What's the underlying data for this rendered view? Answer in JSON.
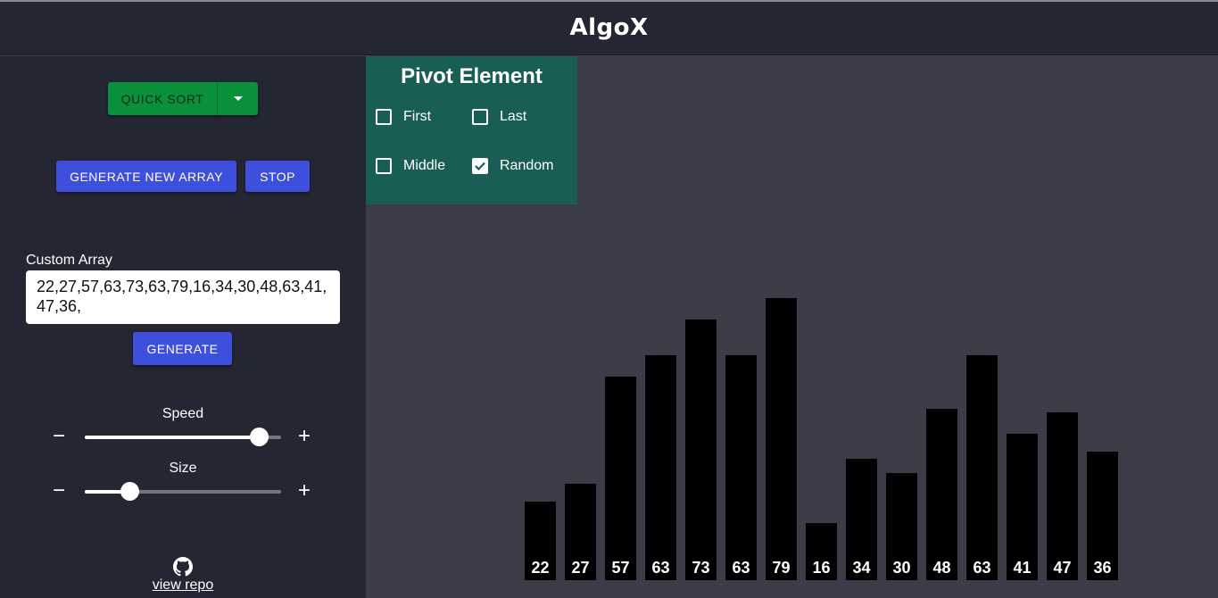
{
  "app": {
    "title": "AlgoX"
  },
  "sidebar": {
    "algorithm_button": {
      "label": "QUICK SORT",
      "color": "#0a8f3a"
    },
    "generate_new_array_label": "GENERATE NEW ARRAY",
    "stop_label": "STOP",
    "custom_array": {
      "label": "Custom Array",
      "value": "22,27,57,63,73,63,79,16,34,30,48,63,41,47,36,"
    },
    "generate_label": "GENERATE",
    "speed": {
      "label": "Speed",
      "minus": "−",
      "plus": "+",
      "level": 0.885
    },
    "size": {
      "label": "Size",
      "minus": "−",
      "plus": "+",
      "level": 0.225
    },
    "repo_link": "view repo"
  },
  "pivot": {
    "title": "Pivot Element",
    "options": [
      {
        "label": "First",
        "checked": false
      },
      {
        "label": "Last",
        "checked": false
      },
      {
        "label": "Middle",
        "checked": false
      },
      {
        "label": "Random",
        "checked": true
      }
    ]
  },
  "chart_data": {
    "type": "bar",
    "values": [
      22,
      27,
      57,
      63,
      73,
      63,
      79,
      16,
      34,
      30,
      48,
      63,
      41,
      47,
      36
    ],
    "bar_color": "#000000"
  },
  "colors": {
    "background": "#3b3c48",
    "sidebar": "#252633",
    "pivot_panel": "#195e55",
    "primary_button": "#3d4fdb"
  }
}
